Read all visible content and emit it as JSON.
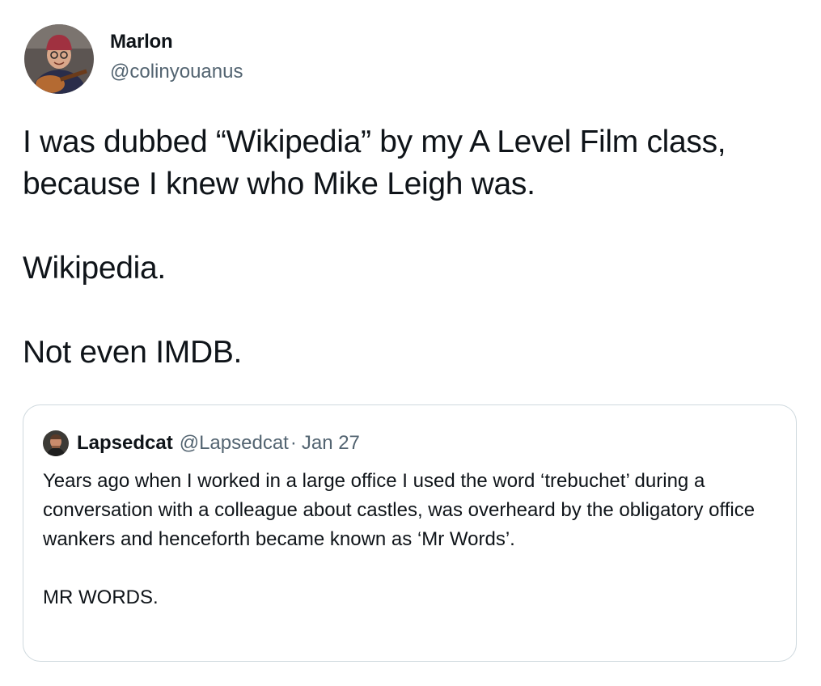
{
  "tweet": {
    "author": {
      "name": "Marlon",
      "handle": "@colinyouanus"
    },
    "text_paragraphs": [
      "I was dubbed “Wikipedia” by my A Level Film class, because I knew who Mike Leigh was.",
      "Wikipedia.",
      "Not even IMDB."
    ]
  },
  "quoted_tweet": {
    "author": {
      "name": "Lapsedcat",
      "handle": "@Lapsedcat"
    },
    "separator": "·",
    "date": "Jan 27",
    "text_paragraphs": [
      "Years ago when I worked in a large office I used the word ‘trebuchet’ during a conversation with a colleague about castles, was overheard by the obligatory office wankers and henceforth became known as ‘Mr Words’.",
      "MR WORDS."
    ]
  },
  "colors": {
    "text_primary": "#0f1419",
    "text_secondary": "#536471",
    "border": "#cfd9de",
    "background": "#ffffff"
  },
  "icons": {
    "author_avatar": "avatar-photo-man-with-guitar",
    "quoted_avatar": "avatar-photo-man"
  }
}
